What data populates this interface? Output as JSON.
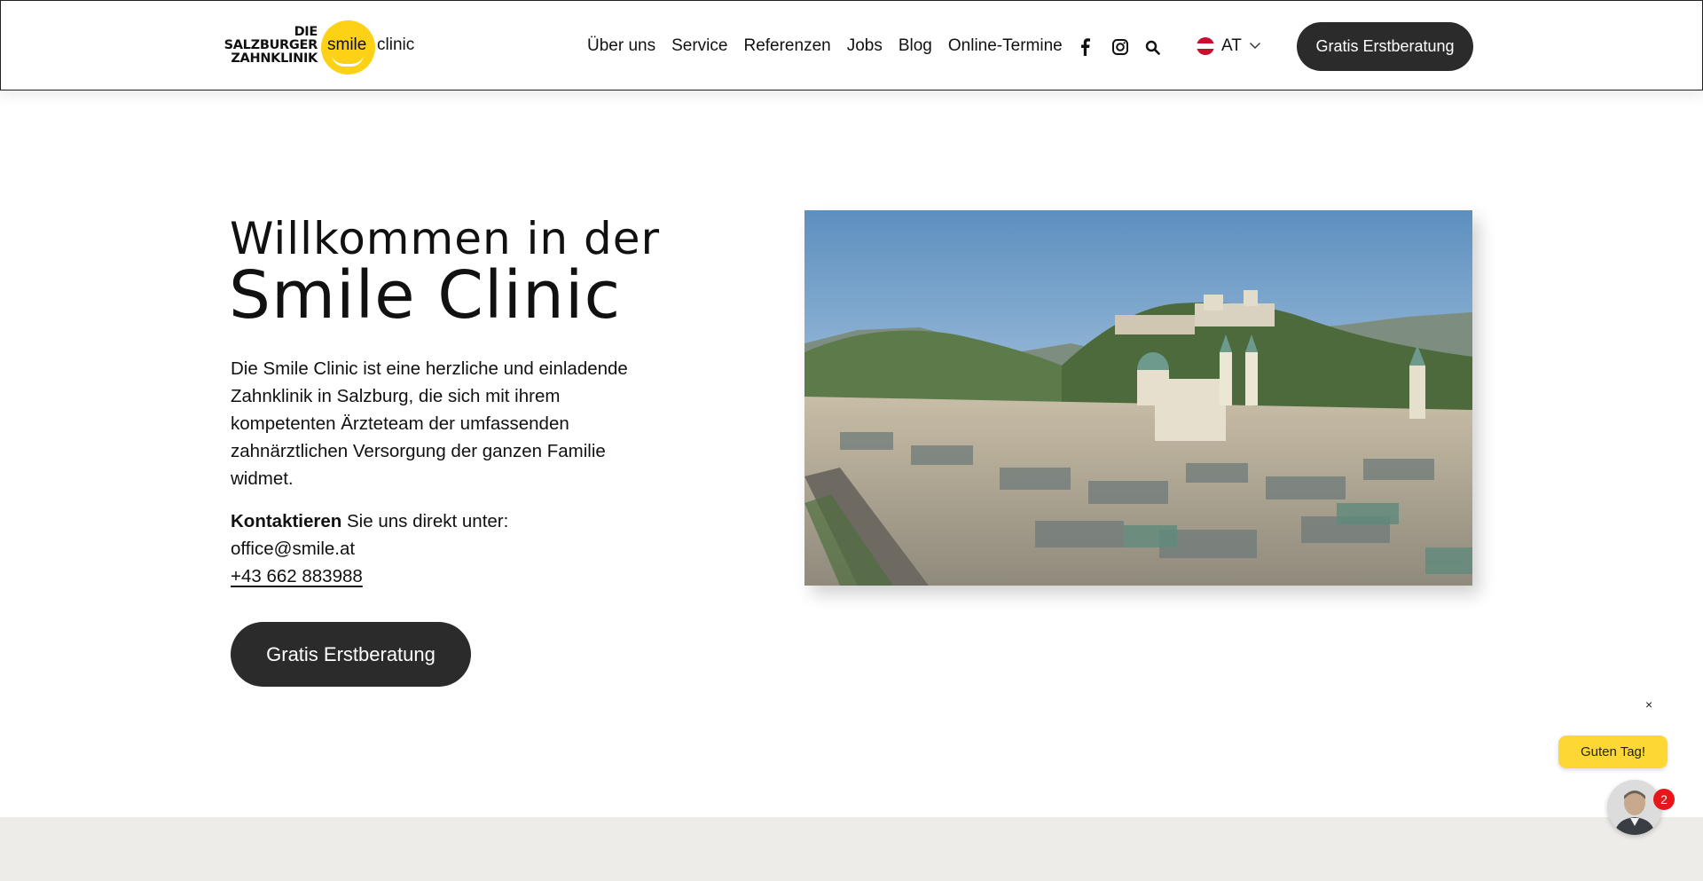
{
  "header": {
    "logo": {
      "line1": "DIE",
      "line2": "SALZBURGER",
      "line3": "ZAHNKLINIK",
      "smile": "smile",
      "clinic": "clinic"
    },
    "nav": [
      {
        "label": "Über uns"
      },
      {
        "label": "Service"
      },
      {
        "label": "Referenzen"
      },
      {
        "label": "Jobs"
      },
      {
        "label": "Blog"
      },
      {
        "label": "Online-Termine"
      }
    ],
    "social_icons": [
      "facebook-icon",
      "instagram-icon",
      "search-icon"
    ],
    "language": {
      "code": "AT",
      "flag": "austria-flag"
    },
    "cta_label": "Gratis Erstberatung"
  },
  "hero": {
    "title_line1": "Willkommen in der",
    "title_line2": "Smile Clinic",
    "description": "Die Smile Clinic ist eine herzliche und einladende Zahnklinik in Salzburg, die sich mit ihrem kompetenten Ärzteteam der umfassenden zahnärztlichen Versorgung der ganzen Familie widmet.",
    "contact_bold": "Kontaktieren",
    "contact_rest": " Sie uns direkt unter:",
    "email": "office@smile.at",
    "phone": "+43 662 883988",
    "cta_label": "Gratis Erstberatung"
  },
  "chat": {
    "close": "×",
    "greeting": "Guten Tag! ",
    "badge_count": "2"
  },
  "colors": {
    "brand_yellow": "#fcd116",
    "button_dark": "#2b2b2b",
    "band_grey": "#eeece8",
    "badge_red": "#e8151b"
  }
}
